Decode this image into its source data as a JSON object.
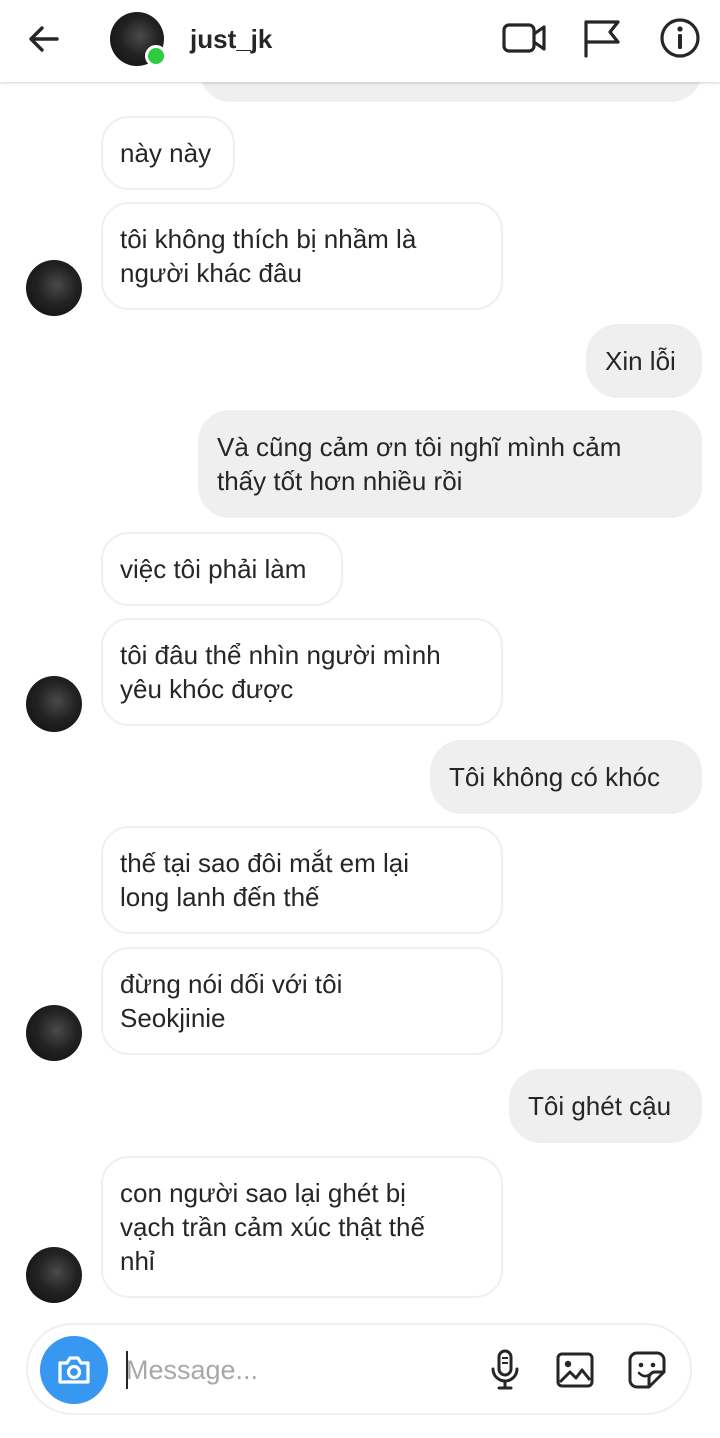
{
  "header": {
    "username": "just_jk",
    "back_icon": "arrow-left-icon",
    "video_icon": "video-camera-icon",
    "flag_icon": "flag-icon",
    "info_icon": "info-icon",
    "online_color": "#2ecc40"
  },
  "messages": [
    {
      "side": "in",
      "text": "này này"
    },
    {
      "side": "in",
      "text": "tôi không thích bị nhầm là\nngười khác đâu"
    },
    {
      "side": "out",
      "text": "Xin lỗi"
    },
    {
      "side": "out",
      "text": "Và cũng cảm ơn tôi nghĩ mình cảm\nthấy tốt hơn nhiều rồi"
    },
    {
      "side": "in",
      "text": "việc tôi phải làm"
    },
    {
      "side": "in",
      "text": "tôi đâu thể nhìn người mình\nyêu khóc được"
    },
    {
      "side": "out",
      "text": "Tôi không có khóc"
    },
    {
      "side": "in",
      "text": "thế tại sao đôi mắt em lại\nlong lanh đến thế"
    },
    {
      "side": "in",
      "text": "đừng nói dối với tôi\nSeokjinie"
    },
    {
      "side": "out",
      "text": "Tôi ghét cậu"
    },
    {
      "side": "in",
      "text": "con người sao lại ghét bị\nvạch trần cảm xúc thật thế\nnhỉ"
    }
  ],
  "composer": {
    "placeholder": "Message...",
    "camera_icon": "camera-icon",
    "mic_icon": "microphone-icon",
    "gallery_icon": "image-icon",
    "sticker_icon": "sticker-icon",
    "accent": "#3897f0"
  }
}
